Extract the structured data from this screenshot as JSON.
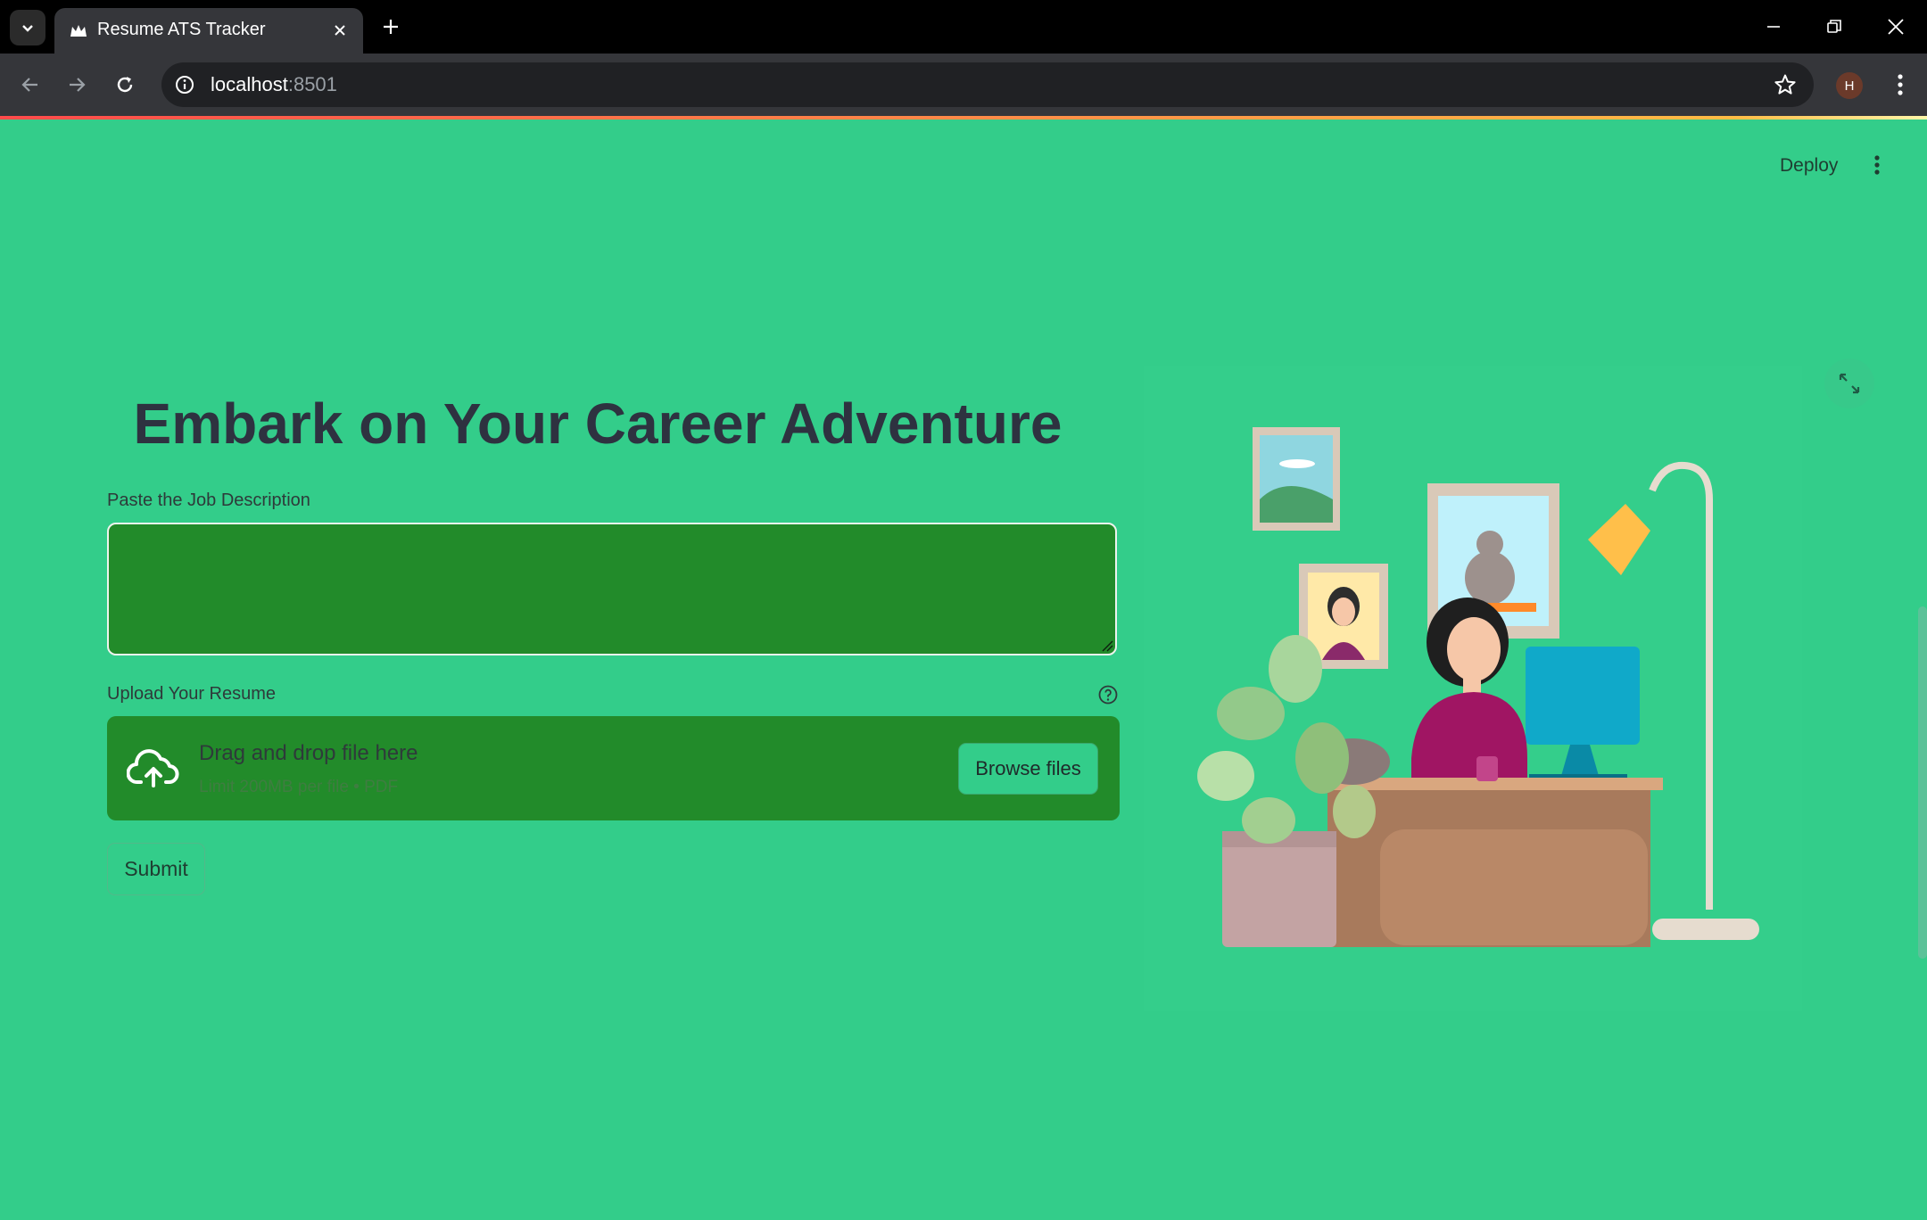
{
  "browser": {
    "tab_title": "Resume ATS Tracker",
    "url_host": "localhost",
    "url_port": ":8501",
    "profile_initial": "H"
  },
  "app": {
    "deploy_label": "Deploy",
    "title": "Embark on Your Career Adventure",
    "job_description": {
      "label": "Paste the Job Description",
      "value": ""
    },
    "resume_upload": {
      "label": "Upload Your Resume",
      "dropzone_title": "Drag and drop file here",
      "dropzone_limit": "Limit 200MB per file • PDF",
      "browse_label": "Browse files"
    },
    "submit_label": "Submit"
  },
  "colors": {
    "page_background": "#33cd8a",
    "input_background": "#228b2a",
    "title_color": "#2e3240",
    "browser_chrome": "#35363a"
  },
  "icons": [
    "chevron-down-icon",
    "crown-favicon-icon",
    "close-icon",
    "plus-icon",
    "minimize-icon",
    "restore-icon",
    "back-arrow-icon",
    "forward-arrow-icon",
    "reload-icon",
    "info-icon",
    "star-icon",
    "kebab-menu-icon",
    "help-circle-icon",
    "cloud-upload-icon",
    "fullscreen-icon"
  ]
}
